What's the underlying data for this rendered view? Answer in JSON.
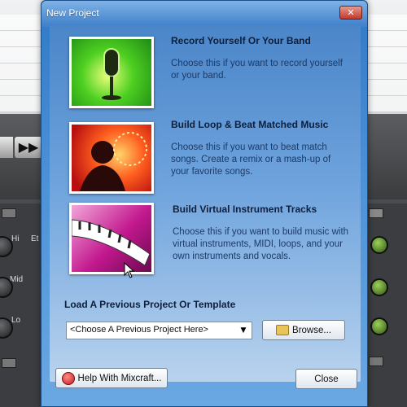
{
  "dialog": {
    "title": "New Project",
    "close_label": "✕",
    "options": [
      {
        "title": "Record Yourself Or Your Band",
        "description": "Choose this if you want to record yourself or your band.",
        "icon": "microphone-image"
      },
      {
        "title": "Build Loop & Beat Matched Music",
        "description": "Choose this if you want to beat match songs.  Create a remix or a mash-up of your favorite songs.",
        "icon": "dj-image"
      },
      {
        "title": "Build Virtual Instrument Tracks",
        "description": "Choose this if you want to build music with virtual instruments, MIDI, loops, and your own instruments and vocals.",
        "icon": "keyboard-image"
      }
    ],
    "load_section_label": "Load A Previous Project Or Template",
    "dropdown_value": "<Choose A Previous Project Here>",
    "browse_label": "Browse...",
    "help_label": "Help With Mixcraft...",
    "close_button_label": "Close"
  },
  "background": {
    "transport_label": "▶▶",
    "mixer_left_labels": [
      "Hi",
      "Mid",
      "Lo"
    ],
    "mixer_left_small": "Et"
  },
  "colors": {
    "dialog_blue": "#3f80c9",
    "title_text": "#0d1f3c",
    "close_red": "#c0392b"
  }
}
